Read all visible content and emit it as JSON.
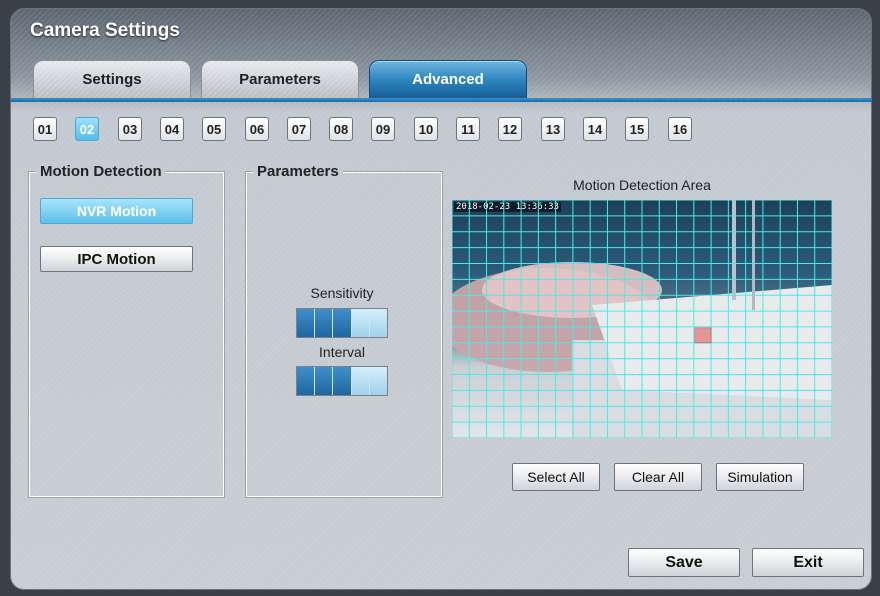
{
  "window": {
    "title": "Camera Settings"
  },
  "tabs": [
    {
      "label": "Settings",
      "active": false
    },
    {
      "label": "Parameters",
      "active": false
    },
    {
      "label": "Advanced",
      "active": true
    }
  ],
  "camera_channels": {
    "items": [
      "01",
      "02",
      "03",
      "04",
      "05",
      "06",
      "07",
      "08",
      "09",
      "10",
      "11",
      "12",
      "13",
      "14",
      "15",
      "16"
    ],
    "selected": "02"
  },
  "motion_detection": {
    "title": "Motion Detection",
    "nvr_button": "NVR Motion",
    "ipc_button": "IPC Motion",
    "selected": "NVR Motion"
  },
  "parameters": {
    "title": "Parameters",
    "sensitivity_label": "Sensitivity",
    "sensitivity_level": 3,
    "sensitivity_max": 5,
    "interval_label": "Interval",
    "interval_level": 3,
    "interval_max": 5
  },
  "area": {
    "title": "Motion Detection Area",
    "timestamp": "2018-02-23 13:36:33",
    "grid_cols": 22,
    "grid_rows": 15,
    "select_all": "Select All",
    "clear_all": "Clear All",
    "simulation": "Simulation"
  },
  "footer": {
    "save": "Save",
    "exit": "Exit"
  },
  "colors": {
    "accent": "#2f86bf",
    "grid": "#3ff0e6",
    "selected_cell": "#e05050"
  }
}
